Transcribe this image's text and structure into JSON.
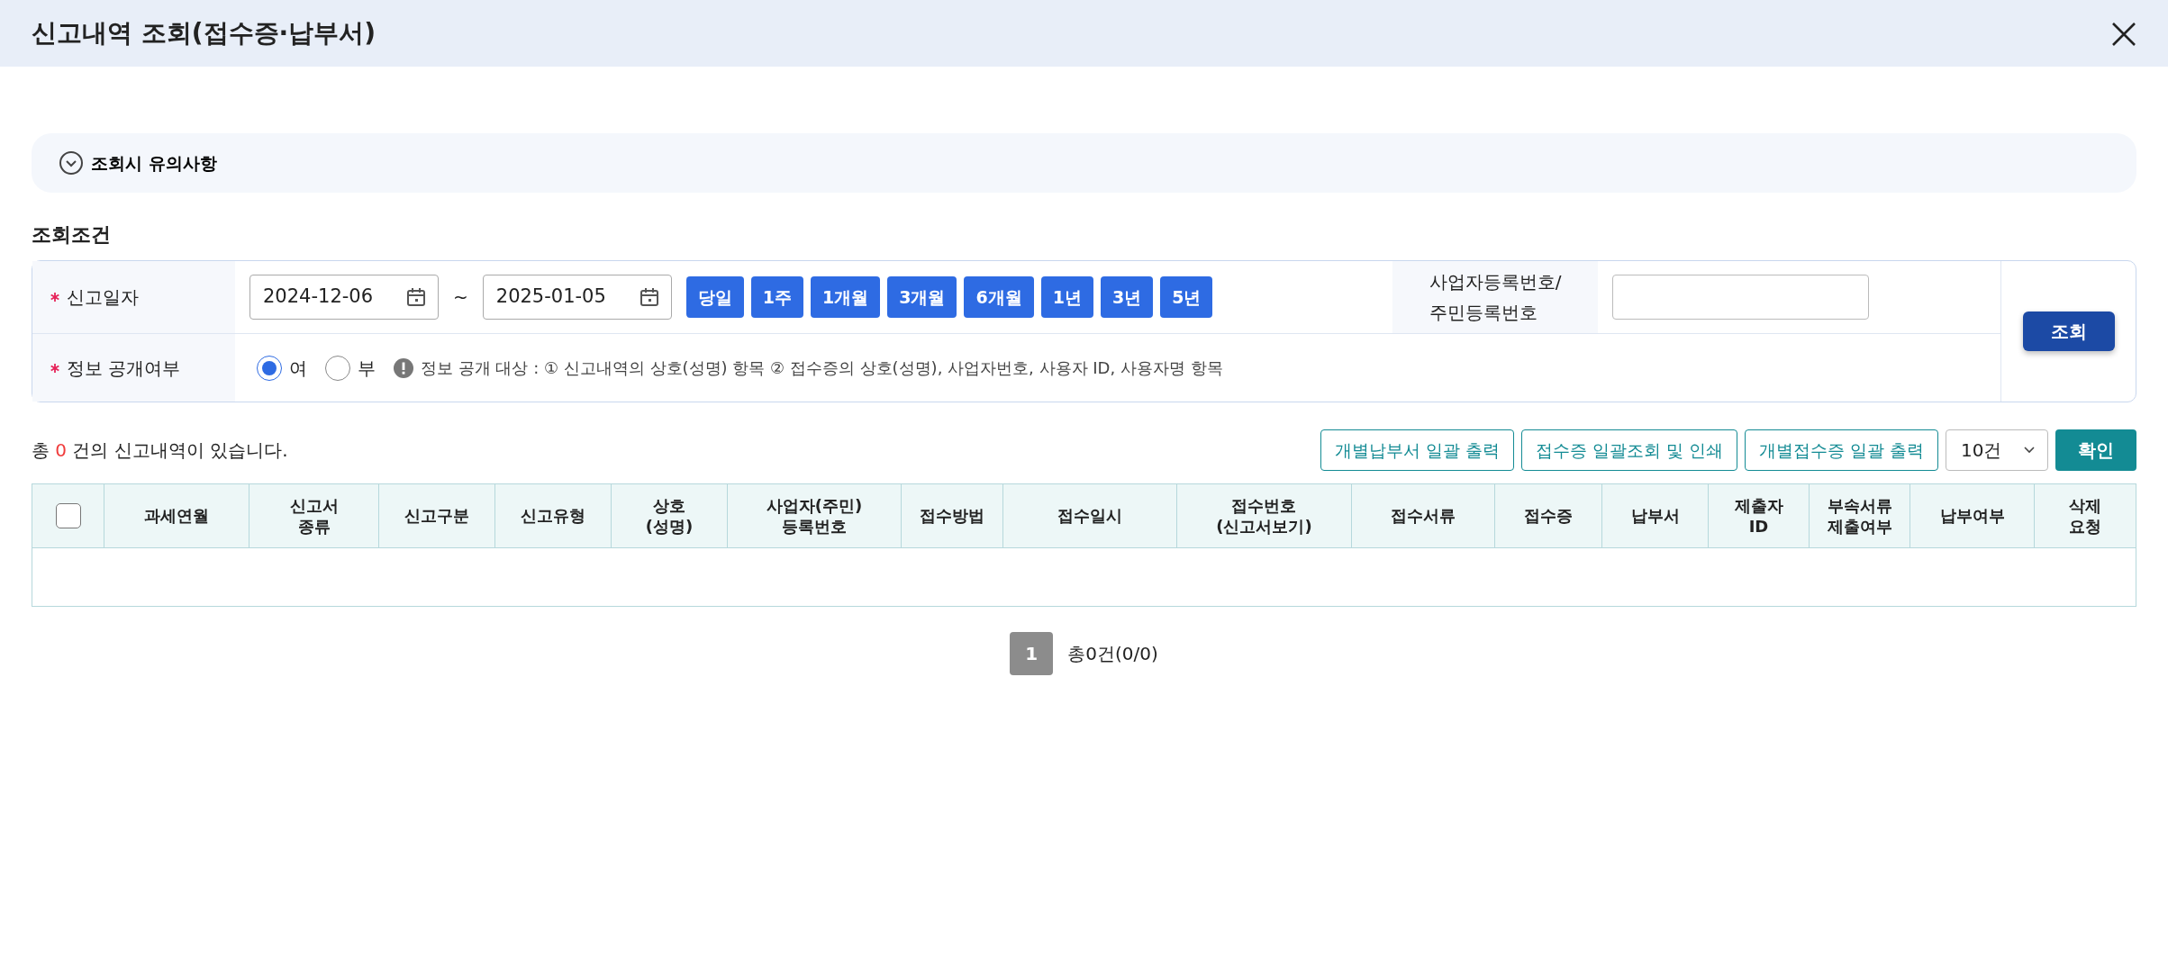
{
  "window": {
    "title": "신고내역 조회(접수증·납부서)"
  },
  "notice": {
    "label": "조회시 유의사항",
    "expanded": false
  },
  "section_title": "조회조건",
  "conditions": {
    "date": {
      "label": "신고일자",
      "required": true,
      "from": "2024-12-06",
      "separator": "~",
      "to": "2025-01-05"
    },
    "periods": [
      {
        "label": "당일"
      },
      {
        "label": "1주"
      },
      {
        "label": "1개월"
      },
      {
        "label": "3개월"
      },
      {
        "label": "6개월"
      },
      {
        "label": "1년"
      },
      {
        "label": "3년"
      },
      {
        "label": "5년"
      }
    ],
    "id_number": {
      "label_lines": [
        "사업자등록번호/",
        "주민등록번호"
      ]
    },
    "disclosure": {
      "label": "정보 공개여부",
      "required": true,
      "options": [
        {
          "label": "여",
          "selected": true
        },
        {
          "label": "부",
          "selected": false
        }
      ],
      "note": "정보 공개 대상 : ① 신고내역의 상호(성명) 항목 ② 접수증의 상호(성명), 사업자번호, 사용자 ID, 사용자명 항목"
    },
    "search_button": "조회"
  },
  "result": {
    "prefix": "총",
    "count": "0",
    "suffix": "건의 신고내역이 있습니다."
  },
  "actions": [
    {
      "label": "개별납부서 일괄 출력"
    },
    {
      "label": "접수증 일괄조회 및 인쇄"
    },
    {
      "label": "개별접수증 일괄 출력"
    }
  ],
  "page_size": "10건",
  "confirm_button": "확인",
  "table": {
    "columns": [
      {
        "kind": "checkbox",
        "checked": false
      },
      {
        "kind": "text",
        "label": "과세연월"
      },
      {
        "kind": "text",
        "label": "신고서\n종류"
      },
      {
        "kind": "text",
        "label": "신고구분"
      },
      {
        "kind": "text",
        "label": "신고유형"
      },
      {
        "kind": "text",
        "label": "상호\n(성명)"
      },
      {
        "kind": "text",
        "label": "사업자(주민)\n등록번호"
      },
      {
        "kind": "text",
        "label": "접수방법"
      },
      {
        "kind": "text",
        "label": "접수일시"
      },
      {
        "kind": "text",
        "label": "접수번호\n(신고서보기)"
      },
      {
        "kind": "text",
        "label": "접수서류"
      },
      {
        "kind": "text",
        "label": "접수증"
      },
      {
        "kind": "text",
        "label": "납부서"
      },
      {
        "kind": "text",
        "label": "제출자\nID"
      },
      {
        "kind": "text",
        "label": "부속서류\n제출여부"
      },
      {
        "kind": "text",
        "label": "납부여부"
      },
      {
        "kind": "text",
        "label": "삭제\n요청"
      }
    ]
  },
  "pagination": {
    "pages": [
      {
        "label": "1",
        "selected": true
      }
    ],
    "total": "총0건(0/0)"
  }
}
